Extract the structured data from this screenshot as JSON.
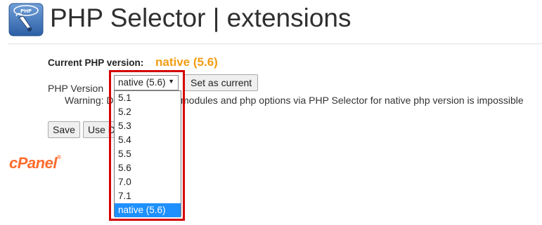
{
  "header": {
    "title": "PHP Selector | extensions",
    "icon": "php-selector-icon"
  },
  "current_version": {
    "label": "Current PHP version:",
    "value": "native (5.6)"
  },
  "version_select": {
    "label": "PHP Version",
    "selected": "native (5.6)",
    "options": [
      "5.1",
      "5.2",
      "5.3",
      "5.4",
      "5.5",
      "5.6",
      "7.0",
      "7.1",
      "native (5.6)"
    ],
    "highlighted_option": "native (5.6)"
  },
  "buttons": {
    "set_current": "Set as current",
    "save": "Save",
    "use_partial": "Use D"
  },
  "warning": {
    "prefix": "Warning: D",
    "suffix": "modules and php options via PHP Selector for native php version is impossible"
  },
  "footer": {
    "logo": "cPanel",
    "logo_mark": "®"
  },
  "colors": {
    "accent": "#f39c12",
    "highlight_border": "#d40000",
    "selected_option": "#1e90ff",
    "cpanel_brand": "#ff6c2c"
  }
}
